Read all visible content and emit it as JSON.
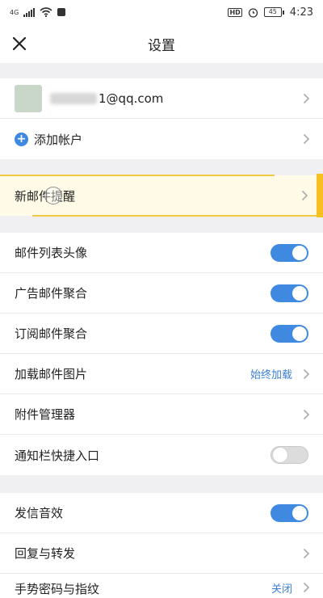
{
  "status_bar": {
    "signal_label": "4G",
    "hd_label": "HD",
    "battery_level": "45",
    "time": "4:23"
  },
  "header": {
    "title": "设置"
  },
  "account": {
    "email": "1@qq.com",
    "add_account_label": "添加帐户"
  },
  "notifications": {
    "new_mail_label": "新邮件提醒"
  },
  "mail_settings": {
    "items": [
      {
        "label": "邮件列表头像",
        "toggle": true
      },
      {
        "label": "广告邮件聚合",
        "toggle": true
      },
      {
        "label": "订阅邮件聚合",
        "toggle": true
      },
      {
        "label": "加载邮件图片",
        "value": "始终加载"
      },
      {
        "label": "附件管理器"
      },
      {
        "label": "通知栏快捷入口",
        "toggle": false
      }
    ]
  },
  "other_settings": {
    "items": [
      {
        "label": "发信音效",
        "toggle": true
      },
      {
        "label": "回复与转发"
      },
      {
        "label": "手势密码与指纹",
        "value": "关闭"
      }
    ]
  },
  "colors": {
    "accent": "#3f8ae0",
    "highlight": "#f5c842"
  }
}
